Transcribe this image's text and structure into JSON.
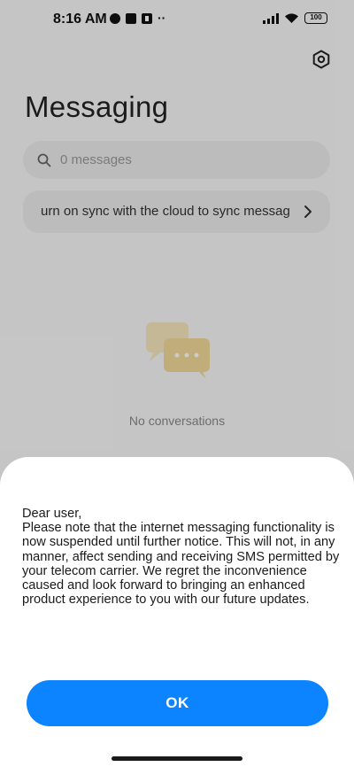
{
  "status_bar": {
    "time": "8:16 AM",
    "battery": "100",
    "more_indicator": "··"
  },
  "header": {
    "title": "Messaging",
    "settings_icon": "settings-hexagon-icon"
  },
  "search": {
    "placeholder": "0 messages",
    "icon": "search-icon"
  },
  "sync_banner": {
    "text": "urn on sync with the cloud to sync messag",
    "icon": "chevron-right-icon"
  },
  "empty_state": {
    "text": "No conversations",
    "icon": "chat-bubbles-icon"
  },
  "dialog": {
    "greeting": "Dear user,",
    "body": "Please note that the internet messaging functionality is now suspended until further notice. This will not, in any manner, affect sending and receiving SMS permitted by your telecom carrier. We regret the inconvenience caused and look forward to bringing an enhanced product experience to you with our future updates.",
    "ok_label": "OK"
  },
  "colors": {
    "accent": "#0d84ff",
    "illustration": "#f1d999"
  }
}
